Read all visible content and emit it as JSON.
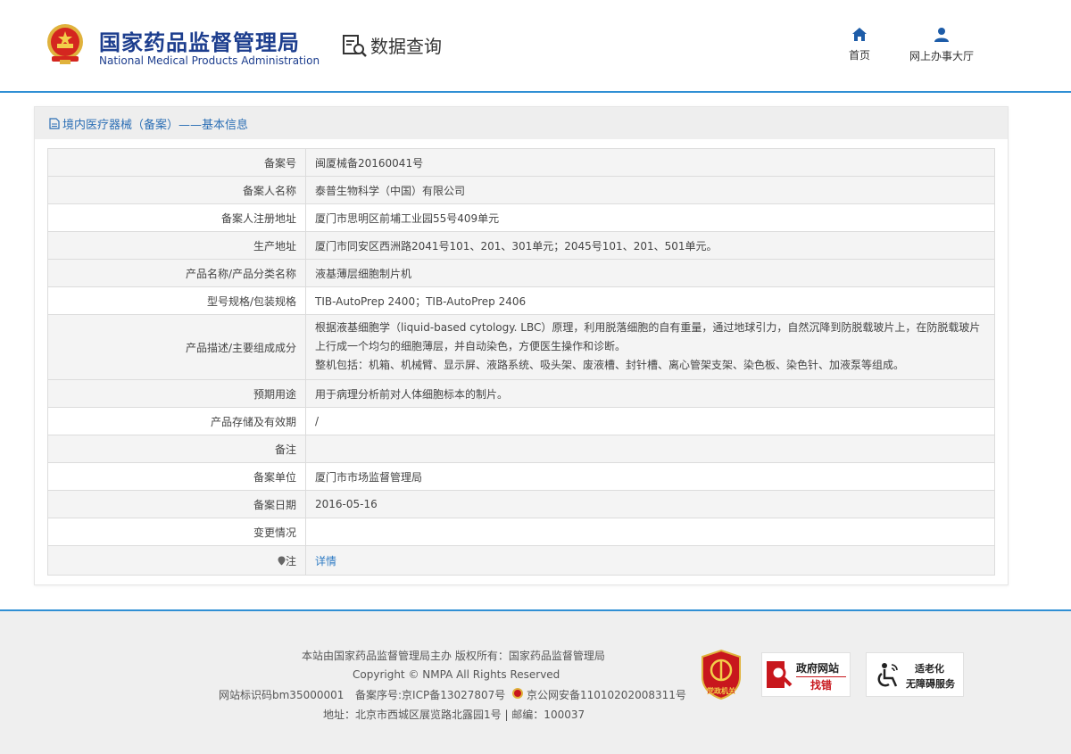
{
  "header": {
    "brand_cn": "国家药品监督管理局",
    "brand_en": "National Medical Products Administration",
    "section": "数据查询",
    "nav": [
      {
        "label": "首页",
        "icon": "home-icon"
      },
      {
        "label": "网上办事大厅",
        "icon": "user-icon"
      }
    ]
  },
  "panel": {
    "title": "境内医疗器械（备案）——基本信息",
    "rows": [
      {
        "label": "备案号",
        "value": "闽厦械备20160041号"
      },
      {
        "label": "备案人名称",
        "value": "泰普生物科学（中国）有限公司"
      },
      {
        "label": "备案人注册地址",
        "value": "厦门市思明区前埔工业园55号409单元"
      },
      {
        "label": "生产地址",
        "value": "厦门市同安区西洲路2041号101、201、301单元；2045号101、201、501单元。"
      },
      {
        "label": "产品名称/产品分类名称",
        "value": "液基薄层细胞制片机"
      },
      {
        "label": "型号规格/包装规格",
        "value": "TIB-AutoPrep 2400；TIB-AutoPrep 2406"
      },
      {
        "label": "产品描述/主要组成成分",
        "value": "根据液基细胞学（liquid-based cytology. LBC）原理，利用脱落细胞的自有重量，通过地球引力，自然沉降到防脱载玻片上，在防脱载玻片上行成一个均匀的细胞薄层，并自动染色，方便医生操作和诊断。",
        "value2": "整机包括：机箱、机械臂、显示屏、液路系统、吸头架、废液槽、封针槽、离心管架支架、染色板、染色针、加液泵等组成。"
      },
      {
        "label": "预期用途",
        "value": "用于病理分析前对人体细胞标本的制片。"
      },
      {
        "label": "产品存储及有效期",
        "value": "/"
      },
      {
        "label": "备注",
        "value": ""
      },
      {
        "label": "备案单位",
        "value": "厦门市市场监督管理局"
      },
      {
        "label": "备案日期",
        "value": "2016-05-16"
      },
      {
        "label": "变更情况",
        "value": ""
      },
      {
        "label": "注",
        "value": "详情"
      }
    ]
  },
  "footer": {
    "line1": "本站由国家药品监督管理局主办 版权所有：国家药品监督管理局",
    "line2": "Copyright © NMPA All Rights Reserved",
    "site_id": "网站标识码bm35000001",
    "icp": "备案序号:京ICP备13027807号",
    "police": "京公网安备11010202008311号",
    "address": "地址：北京市西城区展览路北露园1号 | 邮编：100037",
    "badge_gov_label": "党政机关",
    "badge_error_title": "政府网站",
    "badge_error_sub": "找错",
    "badge_access_title": "适老化",
    "badge_access_sub": "无障碍服务"
  },
  "colors": {
    "brand": "#1d3e8e",
    "accent": "#2f8fd4",
    "link": "#2f7cc4",
    "badge_red": "#c8171d"
  }
}
